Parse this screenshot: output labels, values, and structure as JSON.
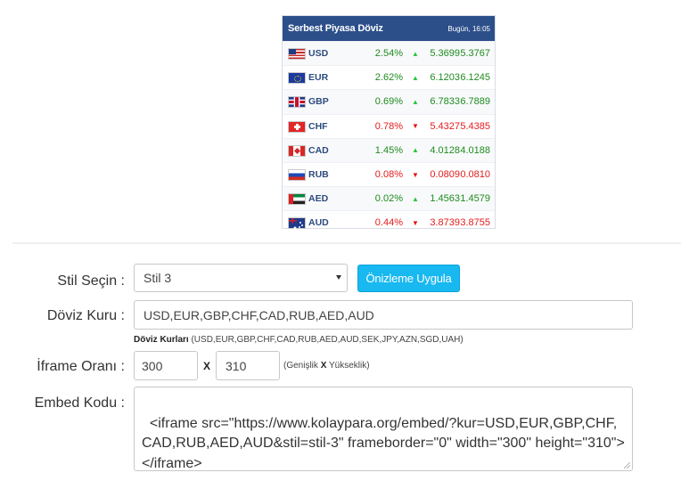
{
  "widget": {
    "title": "Serbest Piyasa Döviz",
    "time": "Bugün, 16:05",
    "rows": [
      {
        "code": "USD",
        "pct": "2.54%",
        "buy": "5.3699",
        "sell": "5.3767",
        "trend": "up",
        "flag": "us-flag-icon"
      },
      {
        "code": "EUR",
        "pct": "2.62%",
        "buy": "6.1203",
        "sell": "6.1245",
        "trend": "up",
        "flag": "eu-flag-icon"
      },
      {
        "code": "GBP",
        "pct": "0.69%",
        "buy": "6.7833",
        "sell": "6.7889",
        "trend": "up",
        "flag": "uk-flag-icon"
      },
      {
        "code": "CHF",
        "pct": "0.78%",
        "buy": "5.4327",
        "sell": "5.4385",
        "trend": "down",
        "flag": "ch-flag-icon"
      },
      {
        "code": "CAD",
        "pct": "1.45%",
        "buy": "4.0128",
        "sell": "4.0188",
        "trend": "up",
        "flag": "ca-flag-icon"
      },
      {
        "code": "RUB",
        "pct": "0.08%",
        "buy": "0.0809",
        "sell": "0.0810",
        "trend": "down",
        "flag": "ru-flag-icon"
      },
      {
        "code": "AED",
        "pct": "0.02%",
        "buy": "1.4563",
        "sell": "1.4579",
        "trend": "up",
        "flag": "ae-flag-icon"
      },
      {
        "code": "AUD",
        "pct": "0.44%",
        "buy": "3.8739",
        "sell": "3.8755",
        "trend": "down",
        "flag": "au-flag-icon"
      }
    ]
  },
  "form": {
    "style_label": "Stil Seçin :",
    "style_value": "Stil 3",
    "preview_button": "Önizleme Uygula",
    "currency_label": "Döviz Kuru :",
    "currency_value": "USD,EUR,GBP,CHF,CAD,RUB,AED,AUD",
    "currency_hint_bold": "Döviz Kurları",
    "currency_hint_list": " (USD,EUR,GBP,CHF,CAD,RUB,AED,AUD,SEK,JPY,AZN,SGD,UAH)",
    "ratio_label": "İframe Oranı :",
    "width_value": "300",
    "x_sep": "X",
    "height_value": "310",
    "ratio_hint_pre": "(Genişlik ",
    "ratio_hint_x": "X",
    "ratio_hint_post": " Yükseklik)",
    "embed_label": "Embed Kodu :",
    "embed_value": "<iframe src=\"https://www.kolaypara.org/embed/?kur=USD,EUR,GBP,CHF,CAD,RUB,AED,AUD&stil=stil-3\" frameborder=\"0\" width=\"300\" height=\"310\"></iframe>"
  },
  "colors": {
    "header_bg": "#2c4f8a",
    "up": "#1e8b1e",
    "down": "#e31b1b",
    "button": "#18b8f0"
  }
}
